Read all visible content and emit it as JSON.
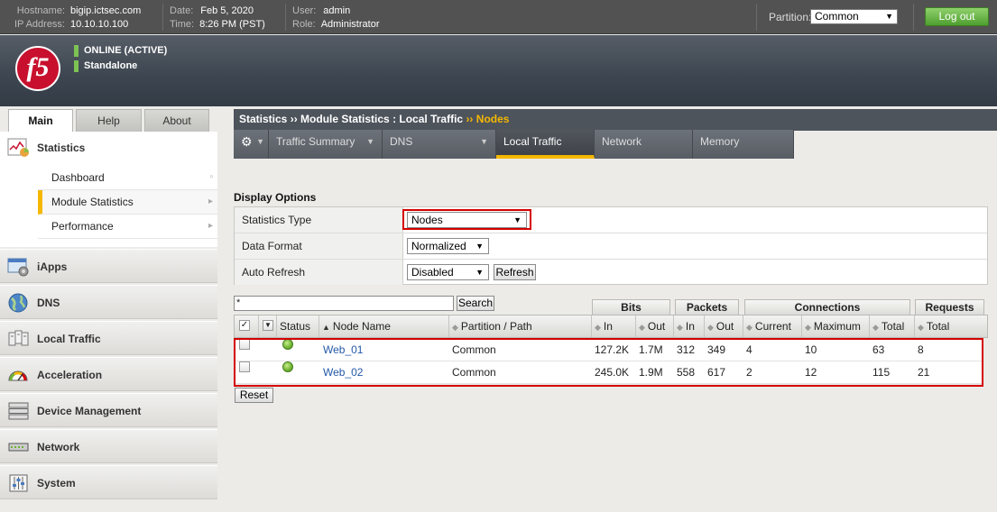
{
  "topbar": {
    "hostname_label": "Hostname:",
    "hostname": "bigip.ictsec.com",
    "ip_label": "IP Address:",
    "ip": "10.10.10.100",
    "date_label": "Date:",
    "date": "Feb 5, 2020",
    "time_label": "Time:",
    "time": "8:26 PM (PST)",
    "user_label": "User:",
    "user": "admin",
    "role_label": "Role:",
    "role": "Administrator",
    "partition_label": "Partition:",
    "partition_value": "Common",
    "logout_label": "Log out"
  },
  "header": {
    "logo_text": "f5",
    "status": "ONLINE (ACTIVE)",
    "mode": "Standalone"
  },
  "left_tabs": [
    "Main",
    "Help",
    "About"
  ],
  "sidebar": {
    "statistics_label": "Statistics",
    "statistics_items": [
      "Dashboard",
      "Module Statistics",
      "Performance"
    ],
    "sections": [
      {
        "label": "iApps",
        "icon": "iapps-icon"
      },
      {
        "label": "DNS",
        "icon": "globe-icon"
      },
      {
        "label": "Local Traffic",
        "icon": "local-traffic-icon"
      },
      {
        "label": "Acceleration",
        "icon": "gauge-icon"
      },
      {
        "label": "Device Management",
        "icon": "server-stack-icon"
      },
      {
        "label": "Network",
        "icon": "network-switch-icon"
      },
      {
        "label": "System",
        "icon": "system-sliders-icon"
      }
    ]
  },
  "breadcrumb": {
    "part1": "Statistics",
    "sep1": "››",
    "part2": "Module Statistics : Local Traffic",
    "sep2": "››",
    "current": "Nodes"
  },
  "nav_tabs": {
    "gear": "⚙",
    "items": [
      "Traffic Summary",
      "DNS",
      "Local Traffic",
      "Network",
      "Memory"
    ],
    "active": "Local Traffic"
  },
  "display_options": {
    "title": "Display Options",
    "rows": [
      {
        "label": "Statistics Type",
        "value": "Nodes"
      },
      {
        "label": "Data Format",
        "value": "Normalized"
      },
      {
        "label": "Auto Refresh",
        "value": "Disabled",
        "button": "Refresh"
      }
    ]
  },
  "search": {
    "value": "*",
    "button": "Search"
  },
  "table": {
    "groups": [
      "Bits",
      "Packets",
      "Connections",
      "Requests"
    ],
    "columns": [
      "Status",
      "Node Name",
      "Partition / Path",
      "In",
      "Out",
      "In",
      "Out",
      "Current",
      "Maximum",
      "Total",
      "Total"
    ],
    "rows": [
      {
        "name": "Web_01",
        "partition": "Common",
        "bits_in": "127.2K",
        "bits_out": "1.7M",
        "pkts_in": "312",
        "pkts_out": "349",
        "conn_current": "4",
        "conn_max": "10",
        "conn_total": "63",
        "req_total": "8"
      },
      {
        "name": "Web_02",
        "partition": "Common",
        "bits_in": "245.0K",
        "bits_out": "1.9M",
        "pkts_in": "558",
        "pkts_out": "617",
        "conn_current": "2",
        "conn_max": "12",
        "conn_total": "115",
        "req_total": "21"
      }
    ],
    "reset_button": "Reset"
  },
  "colors": {
    "accent": "#f5b800",
    "highlight": "#d40000",
    "logout": "#5aab38",
    "status_ok": "#6fb232"
  }
}
